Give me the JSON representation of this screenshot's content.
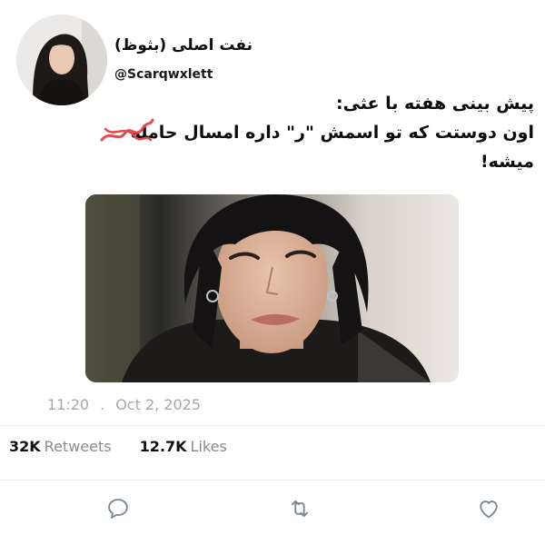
{
  "user": {
    "display_name": "نفت اصلی (بثوظ)",
    "handle": "@Scarqwxlett"
  },
  "tweet": {
    "lines": [
      "پیش بینی هفته با عثی:",
      "اون دوستت که تو اسمش \"ر\" داره امسال حامله",
      "میشه!"
    ]
  },
  "meta": {
    "time": "11:20",
    "separator": ".",
    "date": "Oct 2, 2025"
  },
  "stats": {
    "retweets_count": "32K",
    "retweets_label": "Retweets",
    "likes_count": "12.7K",
    "likes_label": "Likes"
  },
  "colors": {
    "strike_mark": "#e5484d",
    "muted_text": "#8a8a8a",
    "icon_stroke": "#7b8794"
  },
  "icons": {
    "reply": "reply-icon",
    "retweet": "retweet-icon",
    "like": "heart-icon"
  }
}
